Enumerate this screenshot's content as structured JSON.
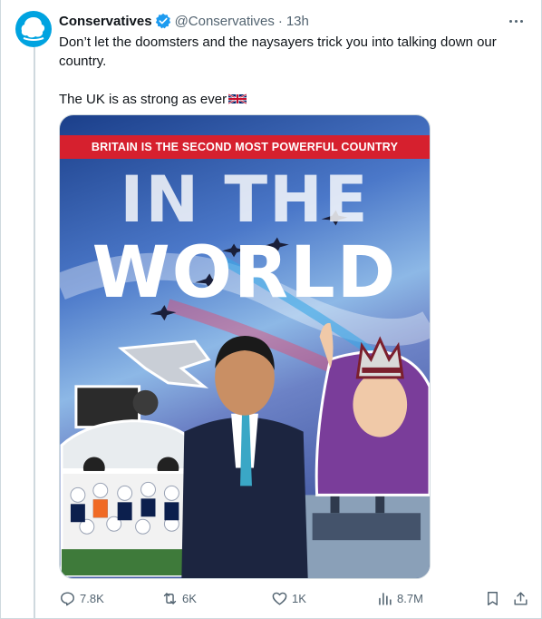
{
  "author": {
    "name": "Conservatives",
    "handle": "@Conservatives",
    "separator": "·",
    "time": "13h"
  },
  "tweet": {
    "line1": "Don’t let the doomsters and the naysayers trick you into talking down our country.",
    "line2": "The UK is as strong as ever"
  },
  "media": {
    "banner": "BRITAIN IS THE SECOND MOST POWERFUL COUNTRY",
    "headline_top": "IN THE",
    "headline_bottom": "WORLD"
  },
  "actions": {
    "replies": "7.8K",
    "reposts": "6K",
    "likes": "1K",
    "views": "8.7M"
  },
  "colors": {
    "brand": "#00a3e0",
    "verified": "#1d9bf0",
    "banner_red": "#d6202e",
    "muted": "#536471"
  },
  "icons": [
    "verified-badge-icon",
    "more-icon",
    "reply-icon",
    "repost-icon",
    "like-icon",
    "views-icon",
    "bookmark-icon",
    "share-icon",
    "uk-flag-icon"
  ]
}
